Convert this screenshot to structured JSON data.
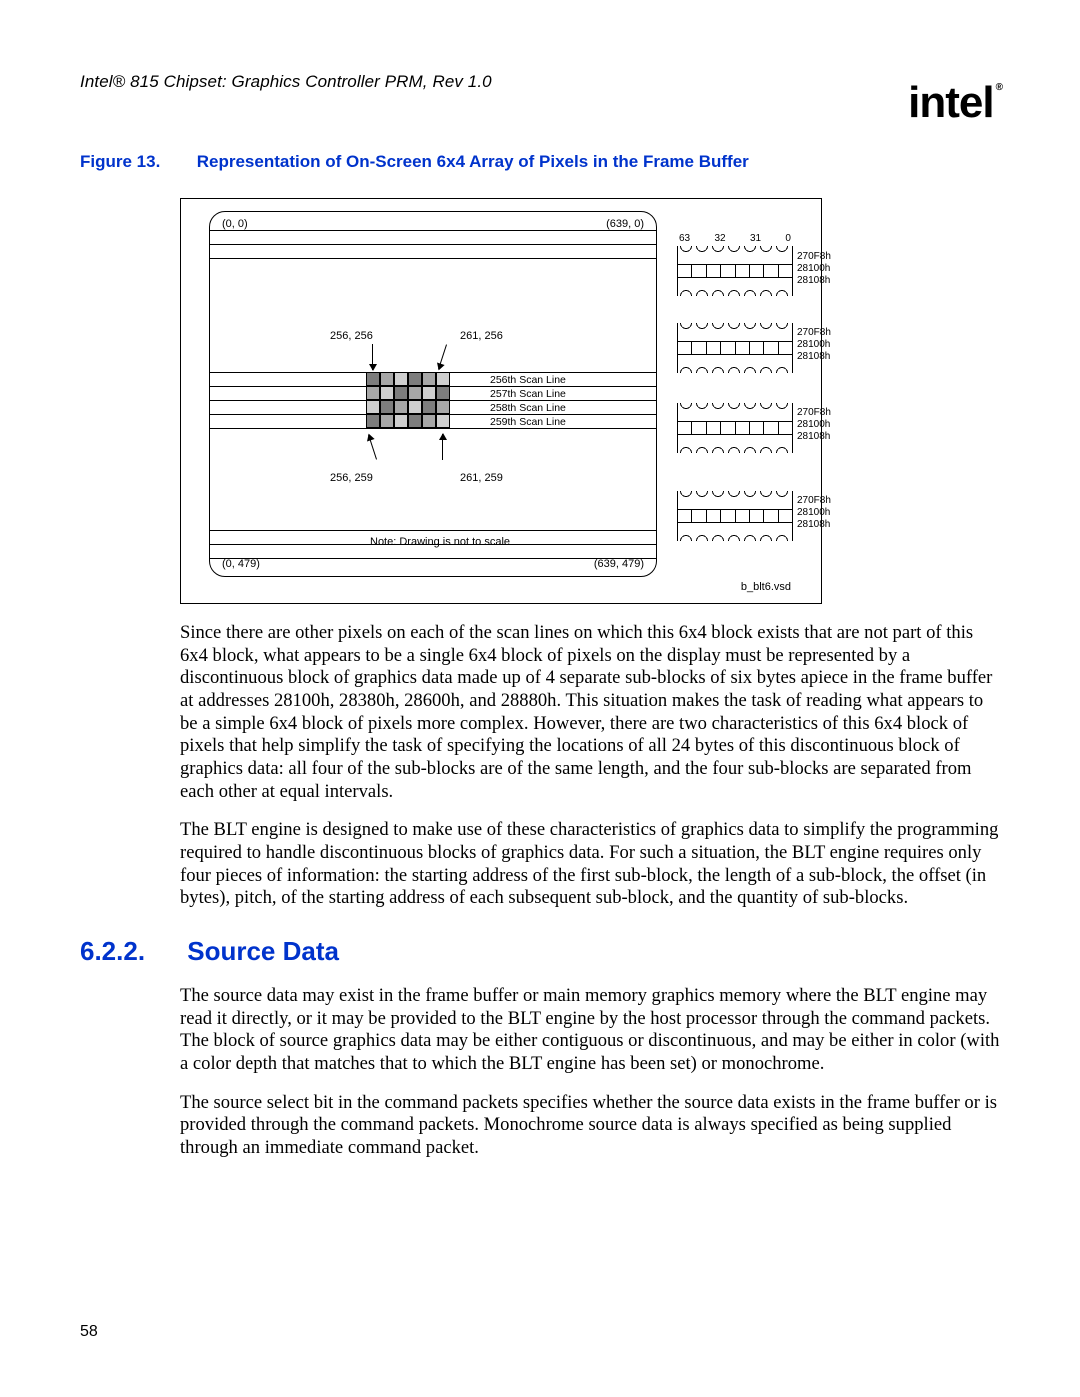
{
  "header": {
    "running": "Intel® 815 Chipset: Graphics Controller PRM, Rev 1.0",
    "logo": "intel",
    "logo_reg": "®"
  },
  "figure": {
    "label": "Figure 13.",
    "title": "Representation of On-Screen 6x4 Array of Pixels in the Frame Buffer",
    "coords": {
      "tl": "(0, 0)",
      "tr": "(639, 0)",
      "bl": "(0, 479)",
      "br": "(639, 479)",
      "p_tl": "256, 256",
      "p_tr": "261, 256",
      "p_bl": "256, 259",
      "p_br": "261, 259"
    },
    "scan": [
      "256th Scan Line",
      "257th Scan Line",
      "258th Scan Line",
      "259th Scan Line"
    ],
    "note": "Note: Drawing is not to scale",
    "bits": [
      "63",
      "32",
      "31",
      "0"
    ],
    "addrs": [
      "270F8h",
      "28100h",
      "28108h"
    ],
    "vsd": "b_blt6.vsd"
  },
  "para1": "Since there are other pixels on each of the scan lines on which this 6x4 block exists that are not part of this 6x4 block, what appears to be a single 6x4 block of pixels on the display must be represented by a discontinuous block of graphics data made up of 4 separate sub-blocks of six bytes apiece in the frame buffer at addresses 28100h, 28380h, 28600h, and 28880h. This situation makes the task of reading what appears to be a simple 6x4 block of pixels more complex. However, there are two characteristics of this 6x4 block of pixels that help simplify the task of specifying the locations of all 24 bytes of this discontinuous block of graphics data: all four of the sub-blocks are of the same length, and the four sub-blocks are separated from each other at equal intervals.",
  "para2": "The BLT engine is designed to make use of these characteristics of graphics data to simplify the programming required to handle discontinuous blocks of graphics data. For such a situation, the BLT engine requires only four pieces of information: the starting address of the first sub-block, the length of a sub-block, the offset (in bytes), pitch, of the starting address of each subsequent sub-block, and the quantity of sub-blocks.",
  "section": {
    "num": "6.2.2.",
    "title": "Source Data"
  },
  "para3": "The source data may exist in the frame buffer or main memory graphics memory where the BLT engine may read it directly, or it may be provided to the BLT engine by the host processor through the command packets. The block of source graphics data may be either contiguous or discontinuous, and may be either in color (with a color depth that matches that to which the BLT engine has been set) or monochrome.",
  "para4": "The source select bit in the command packets specifies whether the source data exists in the frame buffer or is provided through the command packets. Monochrome source data is always specified as being supplied through an immediate command packet.",
  "pagenum": "58"
}
